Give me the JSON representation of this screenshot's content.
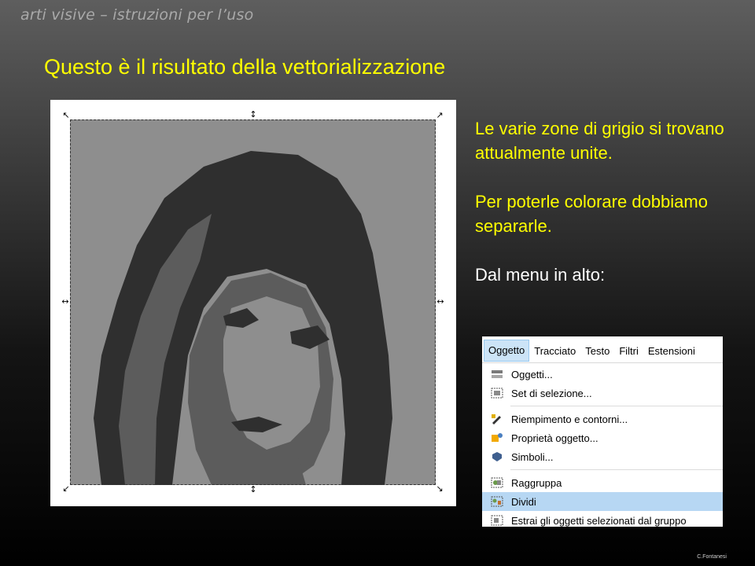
{
  "header": {
    "title": "arti visive – istruzioni per l’uso"
  },
  "slide": {
    "title": "Questo è il risultato della vettorializzazione"
  },
  "body": {
    "paragraph1": "Le varie zone di grigio si trovano attualmente unite.",
    "paragraph2": "Per poterle colorare dobbiamo separarle.",
    "paragraph3": "Dal menu in alto:"
  },
  "menu": {
    "bar": [
      "Oggetto",
      "Tracciato",
      "Testo",
      "Filtri",
      "Estensioni"
    ],
    "active": "Oggetto",
    "items": [
      {
        "label": "Oggetti...",
        "icon": "objects-icon"
      },
      {
        "label": "Set di selezione...",
        "icon": "selection-set-icon"
      },
      {
        "label": "Riempimento e contorni...",
        "icon": "fill-stroke-icon"
      },
      {
        "label": "Proprietà oggetto...",
        "icon": "object-properties-icon"
      },
      {
        "label": "Simboli...",
        "icon": "symbols-icon"
      },
      {
        "label": "Raggruppa",
        "icon": "group-icon"
      },
      {
        "label": "Dividi",
        "icon": "ungroup-icon",
        "highlighted": true
      },
      {
        "label": "Estrai gli oggetti selezionati dal gruppo",
        "icon": "pop-from-group-icon"
      }
    ]
  },
  "footer": {
    "credit": "C.Fontanesi"
  },
  "colors": {
    "title": "#ffff00",
    "header": "#a9a9a9",
    "highlight": "#b7d7f3",
    "gray_light": "#8e8e8e",
    "gray_mid": "#5c5c5c",
    "gray_dark": "#2f2f2f"
  }
}
